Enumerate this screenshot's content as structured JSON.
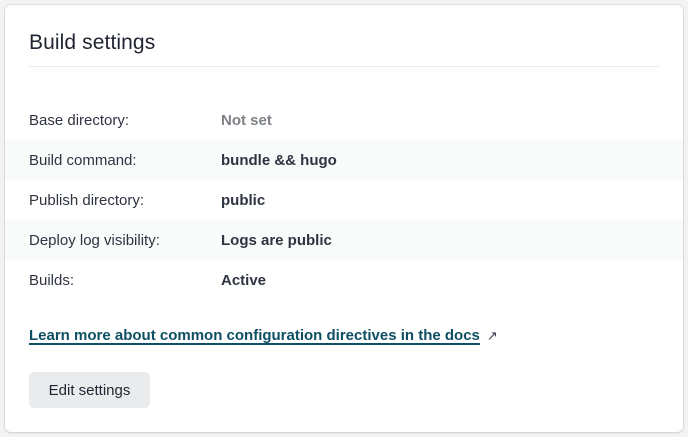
{
  "card": {
    "title": "Build settings"
  },
  "settings": [
    {
      "label": "Base directory:",
      "value": "Not set",
      "muted": true
    },
    {
      "label": "Build command:",
      "value": "bundle && hugo",
      "muted": false
    },
    {
      "label": "Publish directory:",
      "value": "public",
      "muted": false
    },
    {
      "label": "Deploy log visibility:",
      "value": "Logs are public",
      "muted": false
    },
    {
      "label": "Builds:",
      "value": "Active",
      "muted": false
    }
  ],
  "docs_link": {
    "text": "Learn more about common configuration directives in the docs",
    "icon": "external-link-icon"
  },
  "actions": {
    "edit_label": "Edit settings"
  },
  "colors": {
    "link": "#0e4f63",
    "muted_value": "#7d8289",
    "button_bg": "#e9ebed"
  }
}
